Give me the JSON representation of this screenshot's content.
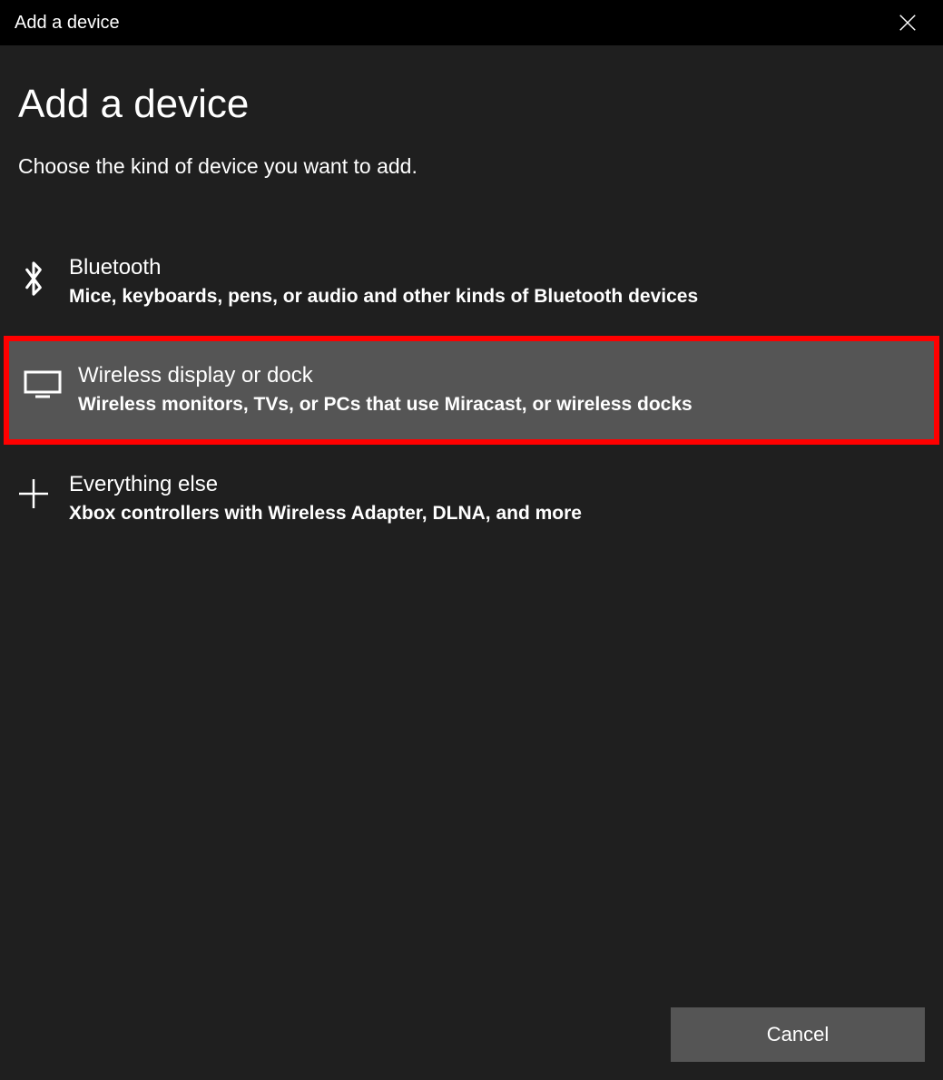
{
  "titlebar": {
    "title": "Add a device"
  },
  "page": {
    "title": "Add a device",
    "subtitle": "Choose the kind of device you want to add."
  },
  "options": [
    {
      "icon": "bluetooth-icon",
      "title": "Bluetooth",
      "desc": "Mice, keyboards, pens, or audio and other kinds of Bluetooth devices",
      "highlighted": false
    },
    {
      "icon": "monitor-icon",
      "title": "Wireless display or dock",
      "desc": "Wireless monitors, TVs, or PCs that use Miracast, or wireless docks",
      "highlighted": true
    },
    {
      "icon": "plus-icon",
      "title": "Everything else",
      "desc": "Xbox controllers with Wireless Adapter, DLNA, and more",
      "highlighted": false
    }
  ],
  "footer": {
    "cancel": "Cancel"
  },
  "highlight_color": "#ff0000"
}
